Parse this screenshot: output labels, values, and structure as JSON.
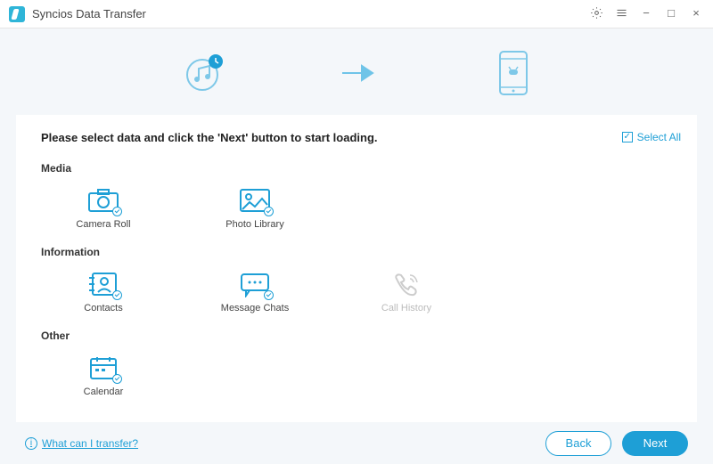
{
  "app": {
    "title": "Syncios Data Transfer"
  },
  "window": {
    "settings": "gear-icon",
    "menu": "menu-icon",
    "min": "−",
    "max": "□",
    "close": "×"
  },
  "flow": {
    "source": "itunes-music-icon",
    "arrow": "arrow-right-icon",
    "target": "android-phone-icon"
  },
  "instruction": "Please select data and click the 'Next' button to start loading.",
  "select_all": {
    "label": "Select All",
    "checked": true
  },
  "sections": {
    "media": {
      "title": "Media",
      "items": [
        {
          "id": "camera-roll",
          "label": "Camera Roll",
          "icon": "camera-icon",
          "checked": true,
          "enabled": true
        },
        {
          "id": "photo-library",
          "label": "Photo Library",
          "icon": "photo-icon",
          "checked": true,
          "enabled": true
        }
      ]
    },
    "information": {
      "title": "Information",
      "items": [
        {
          "id": "contacts",
          "label": "Contacts",
          "icon": "contacts-icon",
          "checked": true,
          "enabled": true
        },
        {
          "id": "message-chats",
          "label": "Message Chats",
          "icon": "message-icon",
          "checked": true,
          "enabled": true
        },
        {
          "id": "call-history",
          "label": "Call History",
          "icon": "phone-icon",
          "checked": false,
          "enabled": false
        }
      ]
    },
    "other": {
      "title": "Other",
      "items": [
        {
          "id": "calendar",
          "label": "Calendar",
          "icon": "calendar-icon",
          "checked": true,
          "enabled": true
        }
      ]
    }
  },
  "footer": {
    "help": "What can I transfer?",
    "back": "Back",
    "next": "Next"
  },
  "colors": {
    "accent": "#1e9fd6",
    "bg": "#f4f7fa",
    "disabled": "#cccccc"
  }
}
